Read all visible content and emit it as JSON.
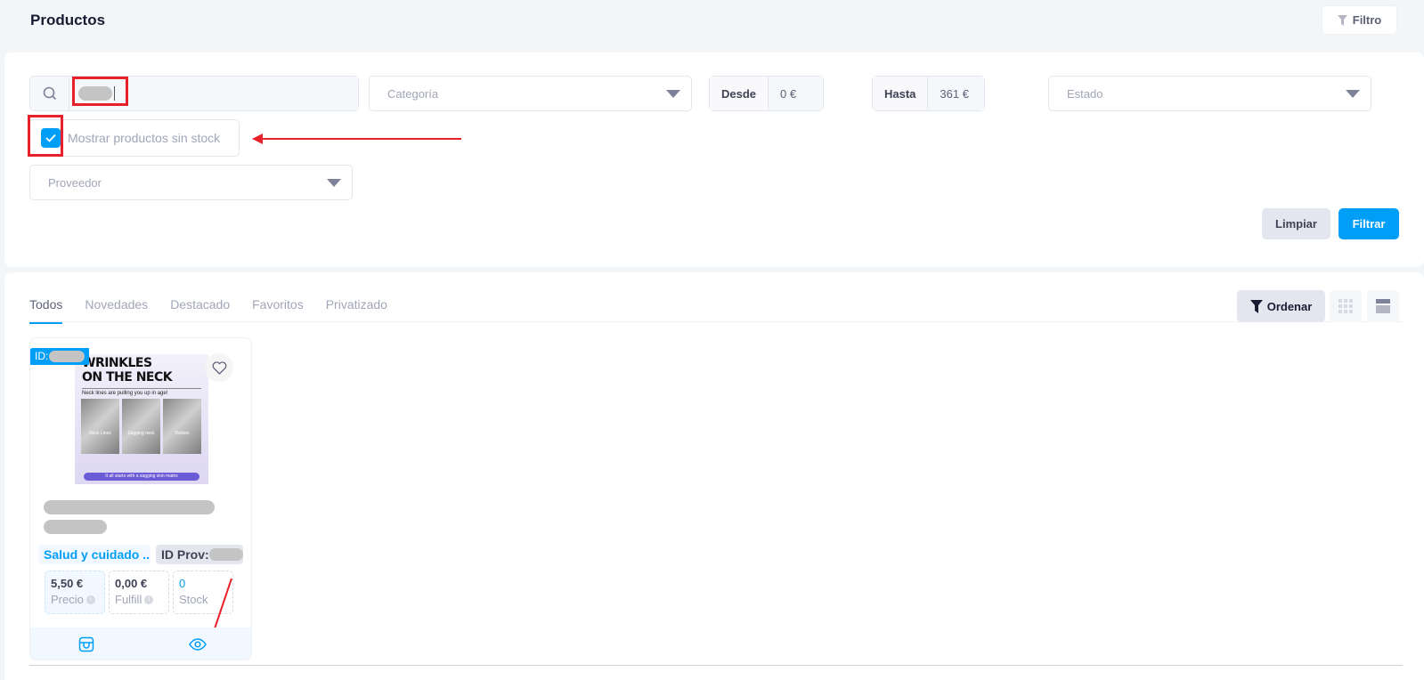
{
  "header": {
    "title": "Productos",
    "filter_toggle_label": "Filtro"
  },
  "filters": {
    "search": {
      "value": "",
      "placeholder": ""
    },
    "category": {
      "placeholder": "Categoría"
    },
    "price_from": {
      "label": "Desde",
      "value": "0 €"
    },
    "price_to": {
      "label": "Hasta",
      "value": "361 €"
    },
    "status": {
      "placeholder": "Estado"
    },
    "show_out_of_stock": {
      "label": "Mostrar productos sin stock",
      "checked": true
    },
    "supplier": {
      "placeholder": "Proveedor"
    },
    "clear_label": "Limpiar",
    "apply_label": "Filtrar"
  },
  "tabs": [
    {
      "label": "Todos",
      "active": true
    },
    {
      "label": "Novedades",
      "active": false
    },
    {
      "label": "Destacado",
      "active": false
    },
    {
      "label": "Favoritos",
      "active": false
    },
    {
      "label": "Privatizado",
      "active": false
    }
  ],
  "toolbar": {
    "order_label": "Ordenar"
  },
  "product": {
    "id_prefix": "ID:",
    "image": {
      "title_line1": "WRINKLES",
      "title_line2": "ON THE NECK",
      "subtitle": "Neck lines are pulling you up in age!",
      "panels": [
        "Neck Lines",
        "Sagging neck",
        "Darken"
      ],
      "footer": "It all starts with a sagging skin matrix"
    },
    "category": "Salud y cuidado ...",
    "supplier_prefix": "ID Prov:",
    "price": {
      "value": "5,50 €",
      "label": "Precio"
    },
    "fulfill": {
      "value": "0,00 €",
      "label": "Fulfill"
    },
    "stock": {
      "value": "0",
      "label": "Stock"
    }
  },
  "colors": {
    "accent": "#009ef7",
    "annotation": "#e8202a"
  }
}
